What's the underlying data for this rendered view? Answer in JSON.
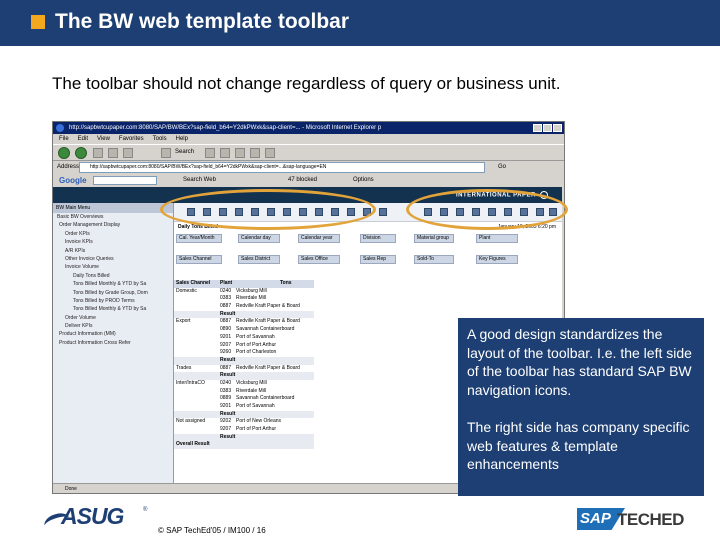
{
  "slide": {
    "title": "The BW web template toolbar",
    "subtitle": "The toolbar should not change regardless of query or business unit."
  },
  "browser": {
    "window_title": "http://sapbwtcupaper.com:8080/SAP/BW/BEx?sap-field_b64=Y2dkPWxk&sap-client=... - Microsoft Internet Explorer p",
    "menu": [
      "File",
      "Edit",
      "View",
      "Favorites",
      "Tools",
      "Help"
    ],
    "search_label": "Search",
    "address_label": "Address",
    "address_value": "http://sapbwtcupaper.com:8080/SAP/BW/BEx?sap-field_b64=Y2dkPWxk&sap-client=...&sap-language=EN",
    "go_label": "Go",
    "google_logo": "Google",
    "google_search": "Search Web",
    "google_blocked": "47 blocked",
    "google_options": "Options",
    "status": "Done"
  },
  "web": {
    "brand": "INTERNATIONAL PAPER",
    "tree_header": "BW Main Menu",
    "tree_items": [
      "Basic BW Overviews",
      "Order Management Display",
      "Order KPIs",
      "Invoice KPIs",
      "A/R KPIs",
      "Other Invoice Queries",
      "Invoice Volume",
      "Daily Tons Billed",
      "Tons Billed Monthly & YTD by Sa",
      "Tons Billed by Grade Group, Dom",
      "Tons Billed by PROD Terms",
      "Tons Billed Monthly & YTD by Sa",
      "Order Volume",
      "Deliver KPIs",
      "Product Information (MM)",
      "Product Information Cross Refer"
    ],
    "report_title": "Daily Tons Billed",
    "report_date": "January 19, 2005 6:20 pm",
    "filters_row1": [
      "Cal. Year/Month",
      "Calendar day",
      "Calendar year",
      "Division",
      "Material group",
      "Plant"
    ],
    "filters_row2": [
      "Sales Channel",
      "Sales District",
      "Sales Office",
      "Sales Rep",
      "Sold-To",
      "Key Figures"
    ],
    "table_headers": [
      "Sales Channel",
      "Plant",
      "Tons"
    ],
    "table_rows": [
      [
        "Domestic",
        "0240",
        "Vicksburg Mill"
      ],
      [
        "",
        "0383",
        "Riverdale Mill"
      ],
      [
        "",
        "0887",
        "Redville Kraft Paper & Board"
      ],
      [
        "",
        "Result",
        ""
      ],
      [
        "Export",
        "0887",
        "Redville Kraft Paper & Board"
      ],
      [
        "",
        "0890",
        "Savannah Containerboard"
      ],
      [
        "",
        "9201",
        "Port of Savannah"
      ],
      [
        "",
        "9207",
        "Port of Port Arthur"
      ],
      [
        "",
        "9260",
        "Port of Charleston"
      ],
      [
        "",
        "Result",
        ""
      ],
      [
        "Trades",
        "0887",
        "Redville Kraft Paper & Board"
      ],
      [
        "",
        "Result",
        ""
      ],
      [
        "Inter/IntraCO",
        "0240",
        "Vicksburg Mill"
      ],
      [
        "",
        "0383",
        "Riverdale Mill"
      ],
      [
        "",
        "0889",
        "Savannah Containerboard"
      ],
      [
        "",
        "9201",
        "Port of Savannah"
      ],
      [
        "",
        "Result",
        ""
      ],
      [
        "Not assigned",
        "9202",
        "Port of New Orleans"
      ],
      [
        "",
        "9207",
        "Port of Port Arthur"
      ],
      [
        "",
        "Result",
        ""
      ],
      [
        "Overall Result",
        "",
        ""
      ]
    ]
  },
  "callout": {
    "p1": "A good design standardizes the layout of the toolbar. I.e. the left side of the toolbar has standard SAP BW navigation icons.",
    "p2": "The right side has company specific web features & template enhancements"
  },
  "footer": {
    "asug": "ASUG",
    "asug_reg": "®",
    "copyright": "© SAP TechEd'05 / IM100 / 16",
    "sap": "SAP",
    "teched": "TECHED"
  },
  "colors": {
    "header_blue": "#1d3f73",
    "accent_orange": "#f4a81d",
    "highlight_ring": "#e2a33a",
    "sap_blue": "#1f6fb8"
  },
  "icons": [
    "logo-square",
    "ie-icon",
    "back-icon",
    "forward-icon",
    "home-icon",
    "bw-toolbar-icon",
    "brand-globe-icon"
  ]
}
